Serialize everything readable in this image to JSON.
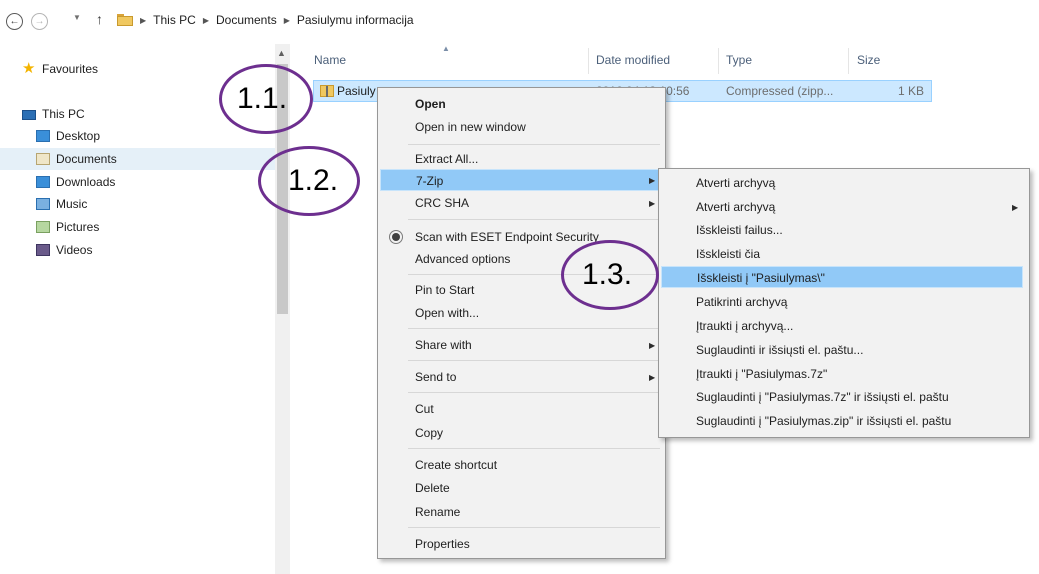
{
  "address_bar": {
    "back": "←",
    "forward": "→",
    "up": "↑",
    "crumbs": [
      "This PC",
      "Documents",
      "Pasiulymu informacija"
    ]
  },
  "nav": {
    "favourites": "Favourites",
    "this_pc": "This PC",
    "items": [
      "Desktop",
      "Documents",
      "Downloads",
      "Music",
      "Pictures",
      "Videos"
    ],
    "selected": "Documents"
  },
  "columns": {
    "name": "Name",
    "date": "Date modified",
    "type": "Type",
    "size": "Size"
  },
  "file": {
    "name": "Pasiuly",
    "date": "2016 04 18 10:56",
    "type": "Compressed (zipp...",
    "size": "1 KB"
  },
  "context_menu": {
    "open": "Open",
    "open_new_window": "Open in new window",
    "extract_all": "Extract All...",
    "seven_zip": "7-Zip",
    "crc_sha": "CRC SHA",
    "scan_eset": "Scan with ESET Endpoint Security",
    "advanced_options": "Advanced options",
    "pin_to_start": "Pin to Start",
    "open_with": "Open with...",
    "share_with": "Share with",
    "send_to": "Send to",
    "cut": "Cut",
    "copy": "Copy",
    "create_shortcut": "Create shortcut",
    "delete": "Delete",
    "rename": "Rename",
    "properties": "Properties"
  },
  "submenu_7zip": {
    "items": [
      "Atverti archyvą",
      "Atverti archyvą",
      "Išskleisti failus...",
      "Išskleisti čia",
      "Išskleisti į \"Pasiulymas\\\"",
      "Patikrinti archyvą",
      "Įtraukti į archyvą...",
      "Suglaudinti ir išsiųsti el. paštu...",
      "Įtraukti į \"Pasiulymas.7z\"",
      "Suglaudinti į \"Pasiulymas.7z\" ir išsiųsti el. paštu",
      "Suglaudinti į \"Pasiulymas.zip\" ir išsiųsti el. paštu"
    ],
    "highlighted_index": 4
  },
  "annotations": {
    "step1": "1.1.",
    "step2": "1.2.",
    "step3": "1.3.",
    "color": "#6d2f8f"
  }
}
